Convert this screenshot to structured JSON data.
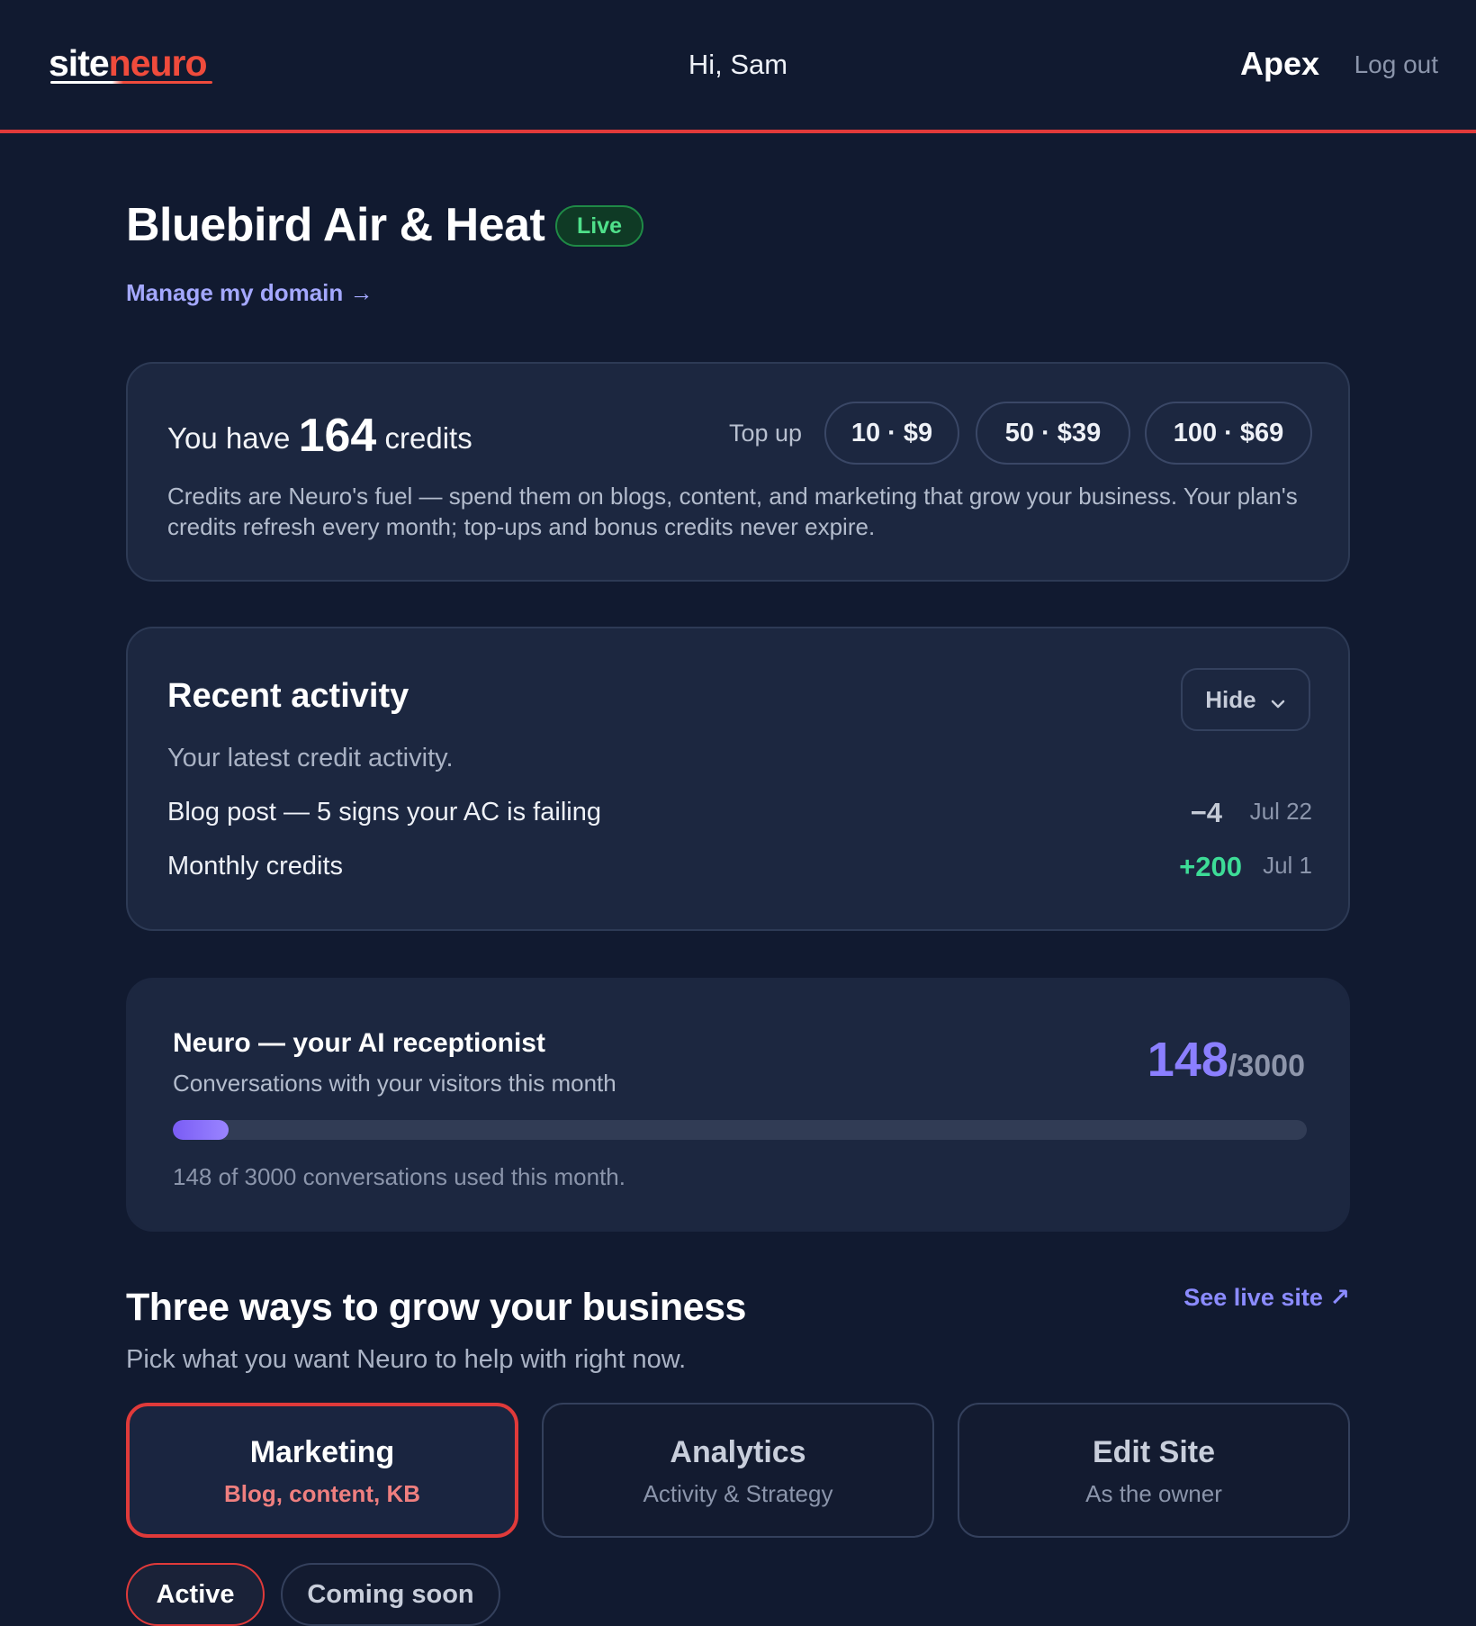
{
  "header": {
    "logo_part1": "site",
    "logo_part2": "neuro",
    "greeting": "Hi, Sam",
    "brand": "Apex",
    "logout": "Log out",
    "accent": "#e03a3a"
  },
  "site": {
    "name": "Bluebird Air & Heat",
    "status": "Live",
    "manage_link": "Manage my domain →"
  },
  "credits": {
    "prefix": "You have",
    "count": "164",
    "suffix": "credits",
    "topup_label": "Top up",
    "options": [
      "10 · $9",
      "50 · $39",
      "100 · $69"
    ],
    "description": "Credits are Neuro's fuel — spend them on blogs, content, and marketing that grow your business. Your plan's credits refresh every month; top-ups and bonus credits never expire."
  },
  "activity": {
    "title": "Recent activity",
    "hide_label": "Hide",
    "subtitle": "Your latest credit activity.",
    "rows": [
      {
        "desc": "Blog post — 5 signs your AC is failing",
        "amount": "−4",
        "date": "Jul 22",
        "color": "#c4cad6"
      },
      {
        "desc": "Monthly credits",
        "amount": "+200",
        "date": "Jul 1",
        "color": "#3ddc97"
      }
    ]
  },
  "neuro": {
    "title": "Neuro — your AI receptionist",
    "subtitle": "Conversations with your visitors this month",
    "used": "148",
    "limit": "/3000",
    "progress_fraction": 0.0493,
    "note": "148 of 3000 conversations used this month."
  },
  "grow": {
    "title": "Three ways to grow your business",
    "live_site": "See live site ↗",
    "subtitle": "Pick what you want Neuro to help with right now.",
    "ways": [
      {
        "title": "Marketing",
        "sub": "Blog, content, KB"
      },
      {
        "title": "Analytics",
        "sub": "Activity & Strategy"
      },
      {
        "title": "Edit Site",
        "sub": "As the owner"
      }
    ],
    "filter_active": "Active",
    "filter_soon": "Coming soon"
  }
}
